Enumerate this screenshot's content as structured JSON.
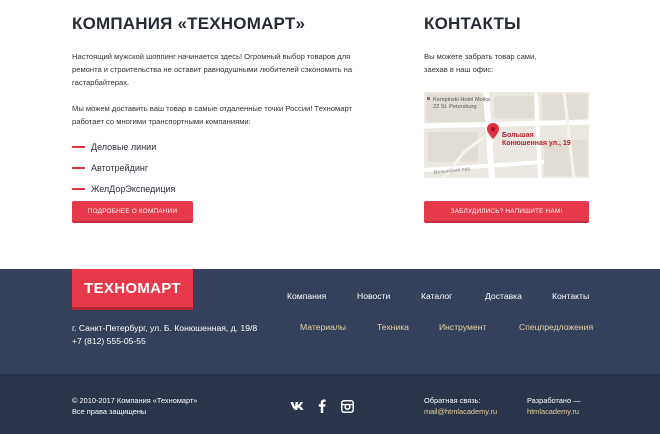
{
  "about": {
    "title": "КОМПАНИЯ «ТЕХНОМАРТ»",
    "paragraph1": "Настоящий мужской шоппинг начинается здесь! Огромный выбор товаров для ремонта и строительства не оставит равнодушными любителей сэкономить на гастарбайтерах.",
    "paragraph2": "Мы можем доставить ваш товар в самые отдаленные точки России! Техномарт работает со многими транспортными компаниями:",
    "partners": [
      "Деловые линии",
      "Автотрейдинг",
      "ЖелДорЭкспедиция"
    ],
    "more_button": "ПОДРОБНЕЕ О КОМПАНИИ"
  },
  "contacts": {
    "title": "КОНТАКТЫ",
    "line1": "Вы можете забрать товар сами,",
    "line2": "заехав в наш офис:",
    "map": {
      "hotel_label_1": "Kempinski Hotel Moika",
      "hotel_label_2": "22 St. Petersburg",
      "pin_label_1": "Большая",
      "pin_label_2": "Конюшенная ул., 19",
      "street_label": "Волынский пер"
    },
    "lost_button": "ЗАБЛУДИЛИСЬ? НАПИШИТЕ НАМ!"
  },
  "footer": {
    "logo": "ТЕХНОМАРТ",
    "nav_main": [
      "Компания",
      "Новости",
      "Каталог",
      "Доставка",
      "Контакты"
    ],
    "nav_sub": [
      "Материалы",
      "Техника",
      "Инструмент",
      "Спецпредложения"
    ],
    "address_line": "г. Санкт-Петербург, ул. Б. Конюшенная, д. 19/8",
    "phone": "+7 (812) 555-05-55",
    "copyright_1": "© 2010-2017 Компания «Техномарт»",
    "copyright_2": "Все права защищены",
    "social": [
      "vk-icon",
      "facebook-icon",
      "instagram-icon"
    ],
    "feedback_label": "Обратная связь:",
    "feedback_email": "mail@htmlacademy.ru",
    "developer_label": "Разработано —",
    "developer_link": "htmlacademy.ru"
  },
  "colors": {
    "accent": "#e8394a",
    "footer_top": "#35415a",
    "footer_bottom": "#2b3549",
    "footer_link_secondary": "#e7d3a1"
  }
}
